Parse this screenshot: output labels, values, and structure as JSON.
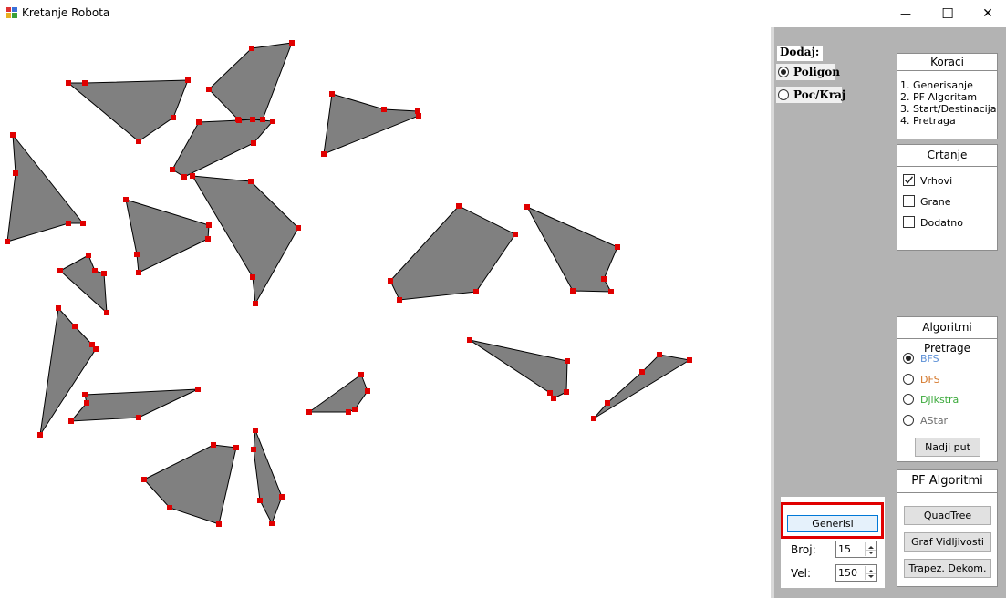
{
  "window": {
    "title": "Kretanje Robota",
    "minimize_glyph": "—",
    "maximize_glyph": "☐",
    "close_glyph": "✕"
  },
  "dodaj": {
    "label": "Dodaj:",
    "options": [
      {
        "label": "Poligon",
        "selected": true
      },
      {
        "label": "Poc/Kraj",
        "selected": false
      }
    ]
  },
  "koraci": {
    "title": "Koraci",
    "steps": [
      "1. Generisanje",
      "2. PF Algoritam",
      "3. Start/Destinacija",
      "4. Pretraga"
    ]
  },
  "crtanje": {
    "title": "Crtanje",
    "items": [
      {
        "label": "Vrhovi",
        "checked": true
      },
      {
        "label": "Grane",
        "checked": false
      },
      {
        "label": "Dodatno",
        "checked": false
      }
    ]
  },
  "pretraga": {
    "title": "Algoritmi Pretrage",
    "options": [
      {
        "label": "BFS",
        "color": "#5b8fd6",
        "selected": true
      },
      {
        "label": "DFS",
        "color": "#d4772a",
        "selected": false
      },
      {
        "label": "Djikstra",
        "color": "#3caa3c",
        "selected": false
      },
      {
        "label": "AStar",
        "color": "#6e6e6e",
        "selected": false
      }
    ],
    "button": "Nadji put"
  },
  "pf": {
    "title": "PF Algoritmi",
    "buttons": [
      "QuadTree",
      "Graf Vidljivosti",
      "Trapez. Dekom."
    ]
  },
  "generate": {
    "button": "Generisi",
    "broj_label": "Broj:",
    "broj_value": "15",
    "vel_label": "Vel:",
    "vel_value": "150"
  },
  "colors": {
    "polygon_fill": "#808080",
    "vertex": "#e00000",
    "highlight": "#e00000"
  }
}
